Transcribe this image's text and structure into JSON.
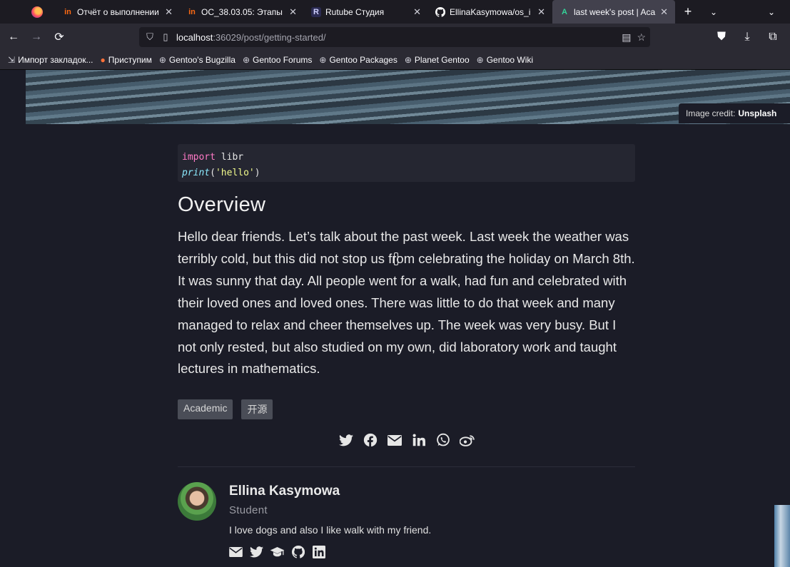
{
  "browser": {
    "tabs": [
      {
        "favicon": "in",
        "favicon_color": "#ff6a13",
        "title": "Отчёт о выполнении",
        "active": false
      },
      {
        "favicon": "in",
        "favicon_color": "#ff6a13",
        "title": "ОС_38.03.05: Этапы",
        "active": false
      },
      {
        "favicon": "R",
        "favicon_color": "#cfd0ff",
        "title": "Rutube Студия",
        "active": false
      },
      {
        "favicon": "github-icon",
        "favicon_color": "#ffffff",
        "title": "EllinaKasymowa/os_i",
        "active": false
      },
      {
        "favicon": "A",
        "favicon_color": "#34d399",
        "title": "last week's post | Aca",
        "active": true
      }
    ],
    "url_host": "localhost",
    "url_path": ":36029/post/getting-started/",
    "bookmarks": [
      {
        "icon": "import-icon",
        "label": "Импорт закладок..."
      },
      {
        "icon": "firefox-icon",
        "label": "Приступим"
      },
      {
        "icon": "globe-icon",
        "label": "Gentoo's Bugzilla"
      },
      {
        "icon": "globe-icon",
        "label": "Gentoo Forums"
      },
      {
        "icon": "globe-icon",
        "label": "Gentoo Packages"
      },
      {
        "icon": "globe-icon",
        "label": "Planet Gentoo"
      },
      {
        "icon": "globe-icon",
        "label": "Gentoo Wiki"
      }
    ]
  },
  "page": {
    "image_credit_prefix": "Image credit:",
    "image_credit_source": "Unsplash",
    "code": {
      "line1_keyword": "import",
      "line1_rest": " libr",
      "line2_func": "print",
      "line2_open": "(",
      "line2_string": "'hello'",
      "line2_close": ")"
    },
    "heading": "Overview",
    "paragraph": "Hello dear friends. Let’s talk about the past week. Last week the weather was terribly cold, but this did not stop us from celebrating the holiday on March 8th. It was sunny that day. All people went for a walk, had fun and celebrated with their loved ones and loved ones. There was little to do that week and many managed to relax and cheer themselves up. The week was very busy. But I not only rested, but also studied on my own, did laboratory work and taught lectures in mathematics.",
    "tags": [
      "Academic",
      "开源"
    ],
    "share_icons": [
      "twitter-icon",
      "facebook-icon",
      "email-icon",
      "linkedin-icon",
      "whatsapp-icon",
      "weibo-icon"
    ],
    "author": {
      "name": "Ellina Kasymowa",
      "role": "Student",
      "bio": "I love dogs and also I like walk with my friend.",
      "link_icons": [
        "email-icon",
        "twitter-icon",
        "graduation-cap-icon",
        "github-icon",
        "linkedin-icon"
      ]
    }
  }
}
